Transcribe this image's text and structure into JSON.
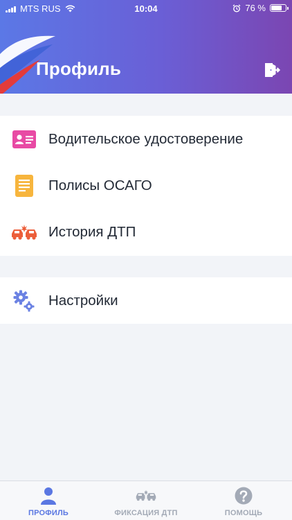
{
  "status_bar": {
    "carrier": "MTS RUS",
    "time": "10:04",
    "battery": "76 %",
    "battery_level": 0.76
  },
  "header": {
    "title": "Профиль",
    "logout_icon": "logout-icon"
  },
  "menu": {
    "items": [
      {
        "label": "Водительское удостоверение",
        "icon": "drivers-license-icon",
        "color": "#e84aa4"
      },
      {
        "label": "Полисы ОСАГО",
        "icon": "document-icon",
        "color": "#f7b53d"
      },
      {
        "label": "История ДТП",
        "icon": "car-crash-icon",
        "color": "#ec5e3a"
      }
    ],
    "settings": {
      "label": "Настройки",
      "icon": "gears-icon",
      "color": "#6b82e3"
    }
  },
  "tab_bar": {
    "tabs": [
      {
        "label": "ПРОФИЛЬ",
        "icon": "person-icon",
        "active": true
      },
      {
        "label": "ФИКСАЦИЯ ДТП",
        "icon": "car-crash-icon",
        "active": false
      },
      {
        "label": "ПОМОЩЬ",
        "icon": "help-icon",
        "active": false
      }
    ]
  },
  "colors": {
    "accent": "#5a77e2",
    "header_gradient_start": "#5b78e6",
    "header_gradient_end": "#7b46b2",
    "inactive_tab": "#a3aab6"
  }
}
